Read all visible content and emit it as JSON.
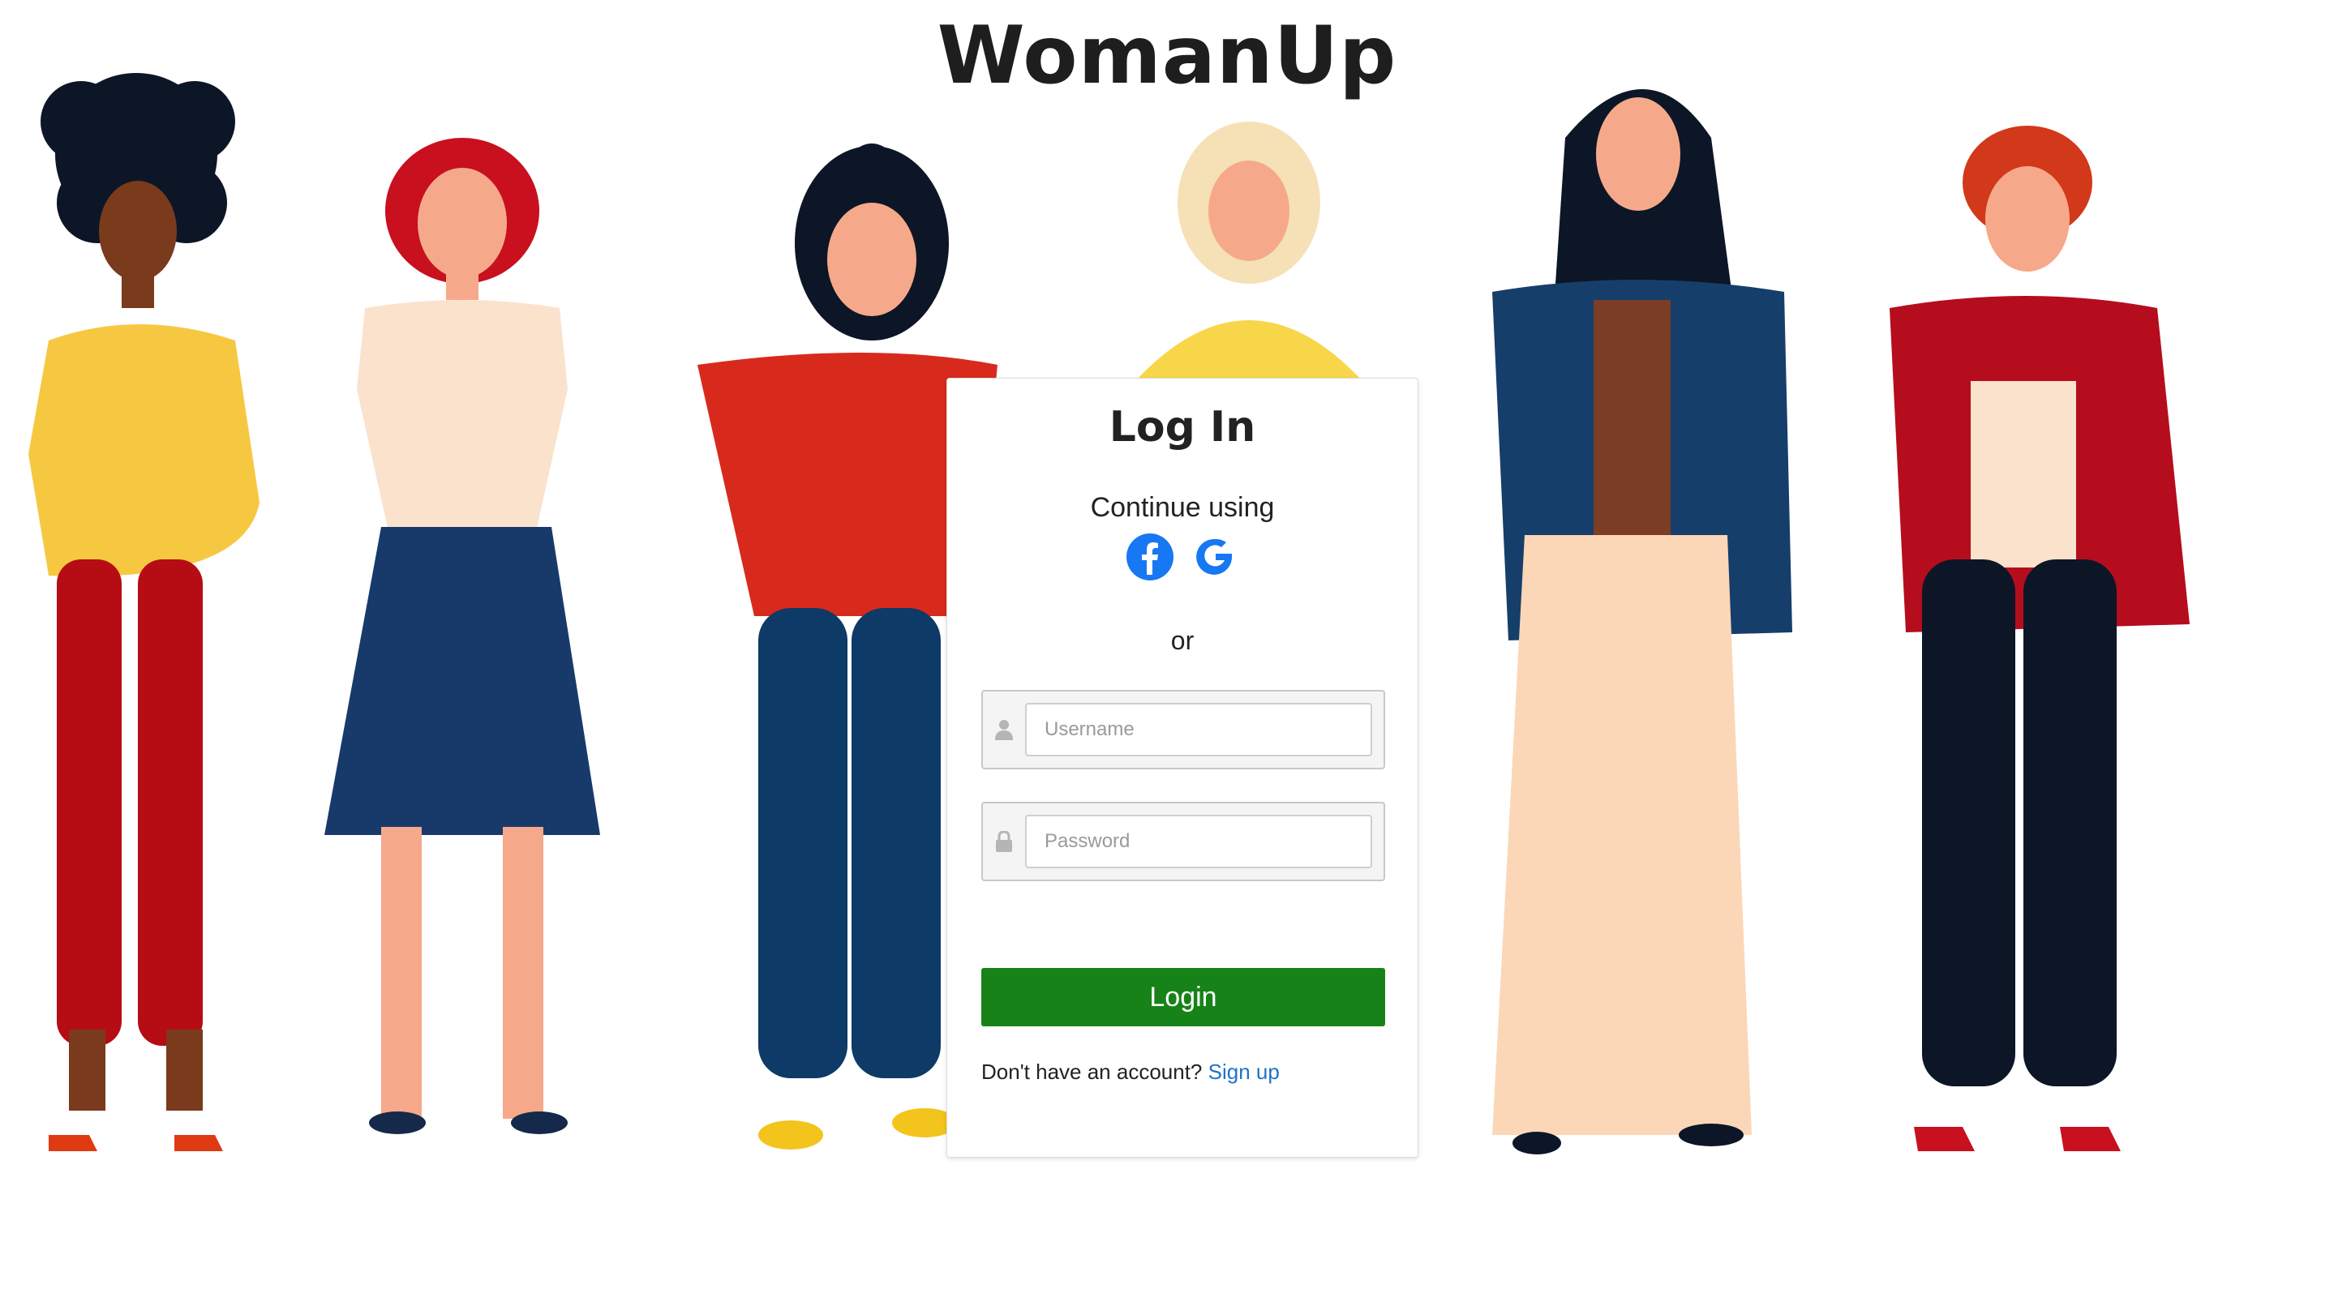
{
  "brand": {
    "title": "WomanUp"
  },
  "login": {
    "title": "Log In",
    "continue_text": "Continue using",
    "social": [
      {
        "name": "facebook-icon",
        "color": "#1877f2"
      },
      {
        "name": "google-icon",
        "color": "#1877f2"
      }
    ],
    "or_text": "or",
    "username_placeholder": "Username",
    "password_placeholder": "Password",
    "login_label": "Login",
    "signup_prompt": "Don't have an account?",
    "signup_link": "Sign up"
  },
  "colors": {
    "login_button": "#178217",
    "link": "#1f72c8",
    "text": "#222222"
  },
  "illustration": {
    "subject": "six-women-figures"
  }
}
